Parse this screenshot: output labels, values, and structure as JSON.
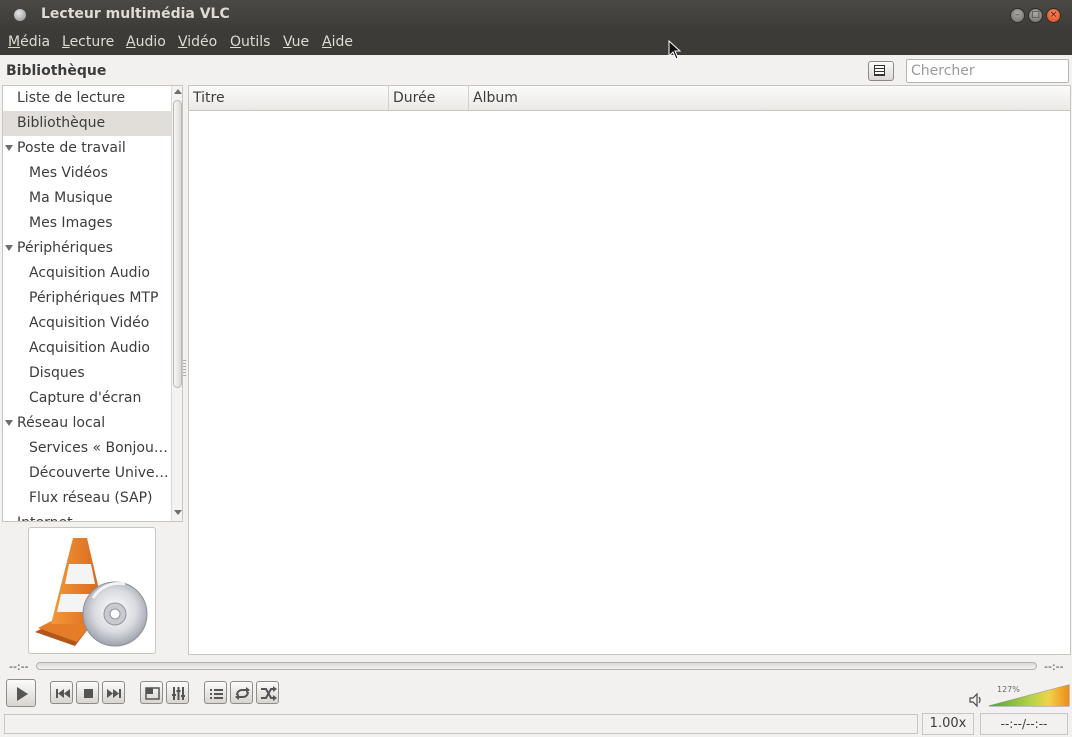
{
  "window": {
    "title": "Lecteur multimédia VLC",
    "controls": {
      "minimize": "–",
      "maximize": "□",
      "close": "×"
    }
  },
  "menu": [
    {
      "accel": "M",
      "rest": "édia"
    },
    {
      "accel": "L",
      "rest": "ecture"
    },
    {
      "accel": "A",
      "rest": "udio"
    },
    {
      "accel": "V",
      "rest": "idéo"
    },
    {
      "accel": "O",
      "rest": "utils"
    },
    {
      "accel": "V",
      "rest": "ue"
    },
    {
      "accel": "A",
      "rest": "ide"
    }
  ],
  "header": {
    "title": "Bibliothèque",
    "view_icon": "list-view-icon",
    "search_placeholder": "Chercher"
  },
  "sidebar": {
    "items": [
      {
        "label": "Liste de lecture",
        "level": 0,
        "expander": false,
        "selected": false
      },
      {
        "label": "Bibliothèque",
        "level": 0,
        "expander": false,
        "selected": true
      },
      {
        "label": "Poste de travail",
        "level": 0,
        "expander": true,
        "selected": false
      },
      {
        "label": "Mes Vidéos",
        "level": 1,
        "expander": false,
        "selected": false
      },
      {
        "label": "Ma Musique",
        "level": 1,
        "expander": false,
        "selected": false
      },
      {
        "label": "Mes Images",
        "level": 1,
        "expander": false,
        "selected": false
      },
      {
        "label": "Périphériques",
        "level": 0,
        "expander": true,
        "selected": false
      },
      {
        "label": "Acquisition Audio",
        "level": 1,
        "expander": false,
        "selected": false
      },
      {
        "label": "Périphériques MTP",
        "level": 1,
        "expander": false,
        "selected": false
      },
      {
        "label": "Acquisition Vidéo",
        "level": 1,
        "expander": false,
        "selected": false
      },
      {
        "label": "Acquisition Audio",
        "level": 1,
        "expander": false,
        "selected": false
      },
      {
        "label": "Disques",
        "level": 1,
        "expander": false,
        "selected": false
      },
      {
        "label": "Capture d'écran",
        "level": 1,
        "expander": false,
        "selected": false
      },
      {
        "label": "Réseau local",
        "level": 0,
        "expander": true,
        "selected": false
      },
      {
        "label": "Services « Bonjour »",
        "level": 1,
        "expander": false,
        "selected": false
      },
      {
        "label": "Découverte Universelle",
        "level": 1,
        "expander": false,
        "selected": false
      },
      {
        "label": "Flux réseau (SAP)",
        "level": 1,
        "expander": false,
        "selected": false
      },
      {
        "label": "Internet",
        "level": 0,
        "expander": false,
        "selected": false
      }
    ]
  },
  "art": {
    "icon": "vlc-cone-icon"
  },
  "table": {
    "columns": [
      "Titre",
      "Durée",
      "Album"
    ],
    "rows": []
  },
  "seek": {
    "elapsed": "--:--",
    "remaining": "--:--",
    "position": 0
  },
  "controls": {
    "play": "play-icon",
    "previous": "previous-icon",
    "stop": "stop-icon",
    "next": "next-icon",
    "fullscreen": "fullscreen-icon",
    "extended": "equalizer-icon",
    "playlist": "playlist-icon",
    "loop": "loop-icon",
    "shuffle": "shuffle-icon"
  },
  "volume": {
    "percent_label": "127%",
    "level": 1.27
  },
  "status": {
    "text": "",
    "speed": "1.00x",
    "time": "--:--/--:--"
  },
  "colors": {
    "titlebar": "#3c3b37",
    "close_button": "#e5531d",
    "selected_row": "#e1ded9"
  }
}
